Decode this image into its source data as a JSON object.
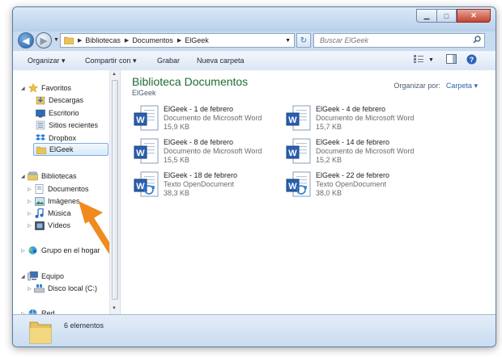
{
  "address": {
    "crumbs": [
      "Bibliotecas",
      "Documentos",
      "ElGeek"
    ]
  },
  "search": {
    "placeholder": "Buscar ElGeek"
  },
  "toolbar": {
    "organize": "Organizar",
    "share": "Compartir con",
    "burn": "Grabar",
    "new_folder": "Nueva carpeta"
  },
  "nav": {
    "favorites": "Favoritos",
    "downloads": "Descargas",
    "desktop": "Escritorio",
    "recent": "Sitios recientes",
    "dropbox": "Dropbox",
    "elgeek": "ElGeek",
    "libraries": "Bibliotecas",
    "documents": "Documentos",
    "images": "Imágenes",
    "music": "Música",
    "videos": "Vídeos",
    "homegroup": "Grupo en el hogar",
    "computer": "Equipo",
    "local_disk": "Disco local (C:)",
    "network": "Red"
  },
  "library": {
    "title": "Biblioteca Documentos",
    "subtitle": "ElGeek",
    "arrange_label": "Organizar por:",
    "arrange_value": "Carpeta"
  },
  "files": [
    {
      "name": "ElGeek - 1 de febrero",
      "type": "Documento de Microsoft Word",
      "size": "15,9 KB",
      "icon": "word-doc-icon"
    },
    {
      "name": "ElGeek - 4 de febrero",
      "type": "Documento de Microsoft Word",
      "size": "15,7 KB",
      "icon": "word-doc-icon"
    },
    {
      "name": "ElGeek - 8 de febrero",
      "type": "Documento de Microsoft Word",
      "size": "15,5 KB",
      "icon": "word-doc-icon"
    },
    {
      "name": "ElGeek - 14 de febrero",
      "type": "Documento de Microsoft Word",
      "size": "15,2 KB",
      "icon": "word-doc-icon"
    },
    {
      "name": "ElGeek - 18 de febrero",
      "type": "Texto OpenDocument",
      "size": "38,3 KB",
      "icon": "odt-doc-icon"
    },
    {
      "name": "ElGeek - 22 de febrero",
      "type": "Texto OpenDocument",
      "size": "38,0 KB",
      "icon": "odt-doc-icon"
    }
  ],
  "status": {
    "count": "6 elementos"
  },
  "colors": {
    "accent": "#1e6b35",
    "link": "#2b66b0",
    "arrow": "#f08a1e",
    "window_frame": "#c9dbef"
  }
}
